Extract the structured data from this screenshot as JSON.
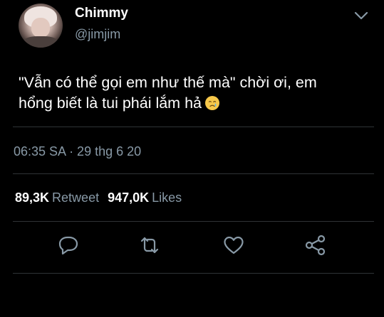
{
  "tweet": {
    "display_name": "Chimmy",
    "handle": "@jimjim",
    "text_line1": "\"Vẫn có thể gọi em như thế mà\" chời ơi, em",
    "text_line2": "hổng biết là tui phái lắm hả",
    "emoji": "crying-face-emoji",
    "timestamp": "06:35 SA · 29 thg 6 20"
  },
  "stats": {
    "retweet_count": "89,3K",
    "retweet_label": "Retweet",
    "likes_count": "947,0K",
    "likes_label": "Likes"
  },
  "icons": {
    "menu": "chevron-down-icon",
    "reply": "reply-icon",
    "retweet": "retweet-icon",
    "like": "heart-icon",
    "share": "share-icon"
  },
  "colors": {
    "background": "#000000",
    "primary_text": "#ffffff",
    "secondary_text": "#8899a6",
    "divider": "#2f3336"
  }
}
